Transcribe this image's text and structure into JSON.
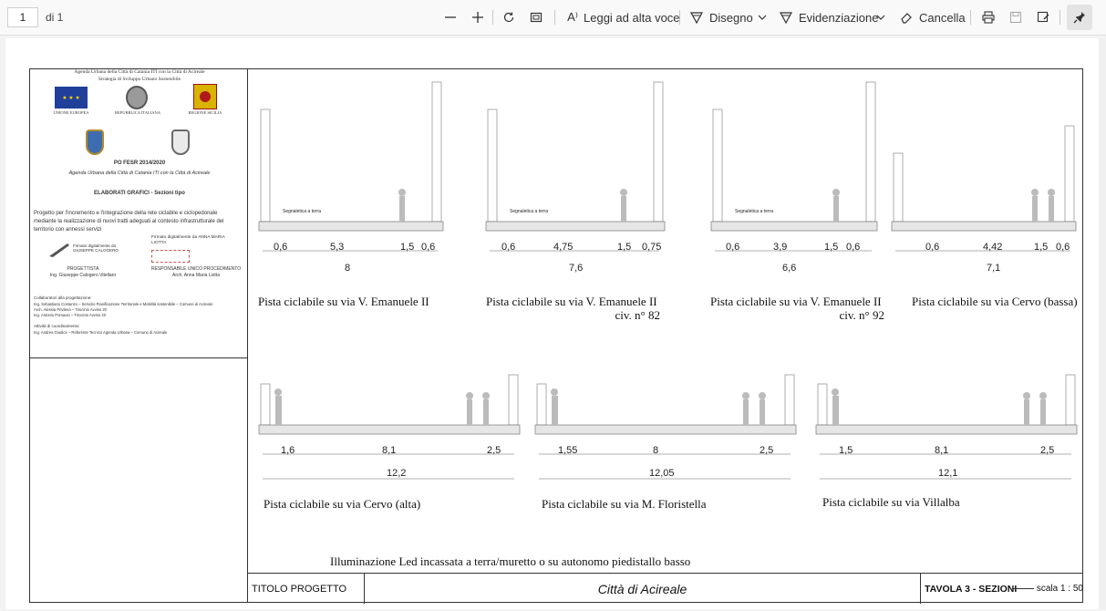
{
  "toolbar": {
    "page_number": "1",
    "page_total": "di 1",
    "read_aloud": "Leggi ad alta voce",
    "draw": "Disegno",
    "highlight": "Evidenziazione",
    "erase": "Cancella",
    "icons": [
      "zoom-out-icon",
      "zoom-in-icon",
      "rotate-icon",
      "fit-page-icon",
      "read-aloud-icon",
      "draw-icon",
      "highlight-icon",
      "eraser-icon",
      "print-icon",
      "save-icon",
      "save-as-icon",
      "pin-icon"
    ]
  },
  "left_panel": {
    "header_line1": "Agenda Urbana della Città di Catania ITI con la Città di Acireale",
    "header_line2": "Strategia di Sviluppo Urbano Sostenibile",
    "logo_eu": "UNIONE EUROPEA",
    "logo_it": "REPUBBLICA ITALIANA",
    "logo_sicily": "REGIONE SICILIA",
    "program": "PO FESR 2014/2020",
    "program_sub": "Agenda Urbana della Città di Catania ITI con la Città di Acireale",
    "elaborati": "ELABORATI GRAFICI - Sezioni tipo",
    "project_desc": "Progetto per l'incremento e l'integrazione della rete ciclabile e ciclopedonale mediante la realizzazione di nuovi tratti adeguati al contesto infrastrutturale del territorio con annessi servizi",
    "signed_by_1": "Firmato digitalmente da GIUSEPPE CALOGERO",
    "signed_by_2": "Firmato digitalmente da ANNA MARIA LIOTTA",
    "role_1": "PROGETTISTA",
    "name_1": "Ing. Giuseppe Calogero Vitellaro",
    "role_2": "RESPONSABILE UNICO PROCEDIMENTO",
    "name_2": "Arch. Anna Maria Liotta",
    "collab_title": "Collaboratori alla progettazione:",
    "collab_1": "Ing. Sebastiano Costanzo – Servizio Pianificazione Territoriale e Mobilità sostenibile – Comune di Acireale",
    "collab_2": "Arch. Alessia Privitera – Tirocinio Avviso 20",
    "collab_3": "Ing. Antonio Pomaoio – Tirocinio Avviso 20",
    "coord_title": "Attività di coordinamento:",
    "coord_1": "Ing. Andrea Giudice – Referente Tecnico Agenda Urbana – Comune di Acireale"
  },
  "sections": [
    {
      "caption": "Pista ciclabile su via V. Emanuele II",
      "caption2": "",
      "dims": [
        "0,6",
        "5,3",
        "1,5",
        "0,6"
      ],
      "total": "8"
    },
    {
      "caption": "Pista ciclabile su via V. Emanuele II",
      "caption2": "civ. n° 82",
      "dims": [
        "0,6",
        "4,75",
        "1,5",
        "0,75"
      ],
      "total": "7,6"
    },
    {
      "caption": "Pista ciclabile su via V. Emanuele II",
      "caption2": "civ. n° 92",
      "dims": [
        "0,6",
        "3,9",
        "1,5",
        "0,6"
      ],
      "total": "6,6"
    },
    {
      "caption": "Pista ciclabile su via Cervo (bassa)",
      "caption2": "",
      "dims": [
        "0,6",
        "4,42",
        "1,5",
        "0,6"
      ],
      "total": "7,1"
    },
    {
      "caption": "Pista ciclabile su via Cervo (alta)",
      "caption2": "",
      "dims": [
        "1,6",
        "8,1",
        "2,5"
      ],
      "total": "12,2"
    },
    {
      "caption": "Pista ciclabile su via M. Floristella",
      "caption2": "",
      "dims": [
        "1,55",
        "8",
        "2,5"
      ],
      "total": "12,05"
    },
    {
      "caption": "Pista ciclabile su via Villalba",
      "caption2": "",
      "dims": [
        "1,5",
        "8,1",
        "2,5"
      ],
      "total": "12,1"
    }
  ],
  "signage_label": "Segnaletica a terra",
  "footnote": "Illuminazione Led incassata a terra/muretto o su autonomo piedistallo basso",
  "footer": {
    "project_label": "TITOLO PROGETTO",
    "city": "Città di Acireale",
    "sheet": "TAVOLA 3 - SEZIONI",
    "scale": "scala 1 : 50"
  }
}
